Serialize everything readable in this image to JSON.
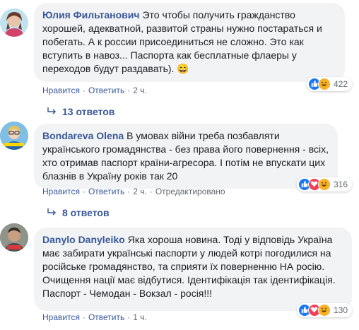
{
  "comments": [
    {
      "author": "Юлия Фильтанович",
      "text": "Это чтобы получить гражданство хорошей, адекватной, развитой страны нужно постараться и побегать. А к россии присоединиться не сложно. Это как вступить в навоз... Паспорта как бесплатные флаеры у переходов будут раздавать). 😄",
      "like_label": "Нравится",
      "reply_label": "Ответить",
      "time": "2 ч.",
      "edited": "",
      "reaction_count": "422",
      "reactions": [
        "like-icon",
        "haha-icon"
      ],
      "replies": "13 ответов"
    },
    {
      "author": "Bondareva Olena",
      "text": "В умовах війни треба позбавляти українського громадянства - без права його повернення - всіх, хто отримав паспорт країни-агресора. І потім не впускати цих блазнів в Україну років так 20",
      "like_label": "Нравится",
      "reply_label": "Ответить",
      "time": "2 ч.",
      "edited": "Отредактировано",
      "reaction_count": "316",
      "reactions": [
        "like-icon",
        "love-icon",
        "haha-icon"
      ],
      "replies": "8 ответов"
    },
    {
      "author": "Danylo Danyleiko",
      "text": "Яка хороша новина. Тоді у відповідь Україна має забирати українські паспорти у людей котрі погодилися на російське громадянство, та сприяти їх поверненню НА росію.\nОчищення нації має відбутися. Ідентифікація так ідентифікація. Паспорт - Чемодан - Вокзал - росія!!!",
      "like_label": "Нравится",
      "reply_label": "Ответить",
      "time": "1 ч.",
      "edited": "",
      "reaction_count": "130",
      "reactions": [
        "like-icon",
        "love-icon",
        "haha-icon"
      ],
      "replies": ""
    }
  ],
  "colors": {
    "link": "#385898",
    "bubble": "#f2f3f5",
    "like": "#1877f2",
    "love": "#f33e58",
    "haha": "#f7b125"
  }
}
